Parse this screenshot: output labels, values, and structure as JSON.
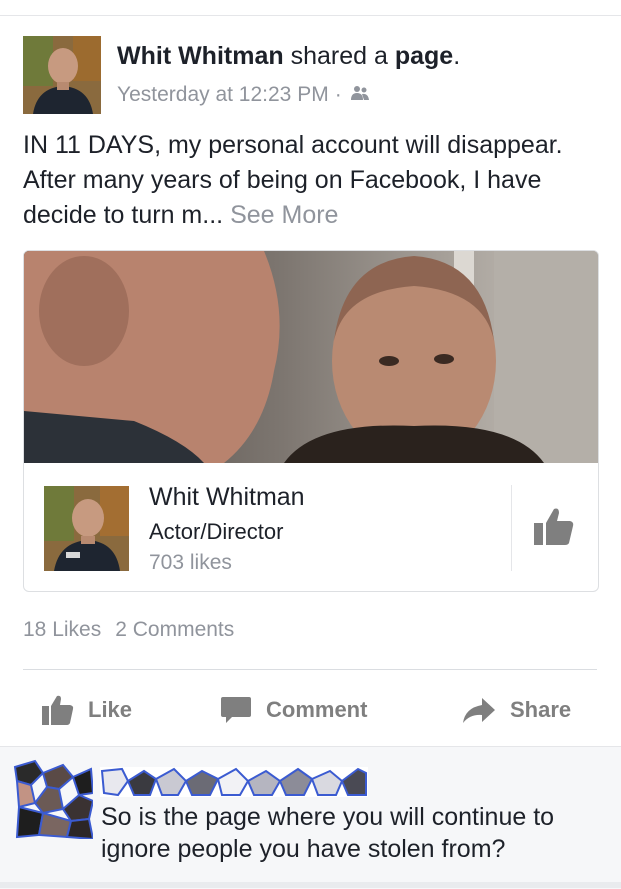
{
  "post": {
    "author": "Whit Whitman",
    "action_text": "shared a",
    "object_text": "page",
    "punct": ".",
    "timestamp": "Yesterday at 12:23 PM",
    "separator": "·",
    "audience_icon": "friends-icon",
    "text": "IN 11 DAYS, my personal account will disappear. After many years of being on Facebook, I have decide to turn m...",
    "see_more": "See More"
  },
  "shared_page": {
    "name": "Whit Whitman",
    "category": "Actor/Director",
    "likes": "703 likes",
    "like_icon": "thumbs-up-icon"
  },
  "counts": {
    "likes": "18 Likes",
    "comments": "2 Comments"
  },
  "actions": {
    "like": "Like",
    "comment": "Comment",
    "share": "Share"
  },
  "comment": {
    "text": "So is the page where you will continue to ignore people you have stolen from?"
  },
  "colors": {
    "text": "#1d2129",
    "secondary": "#90949c",
    "action_gray": "#7f7f7f",
    "redaction_blue": "#3b5bd1"
  }
}
